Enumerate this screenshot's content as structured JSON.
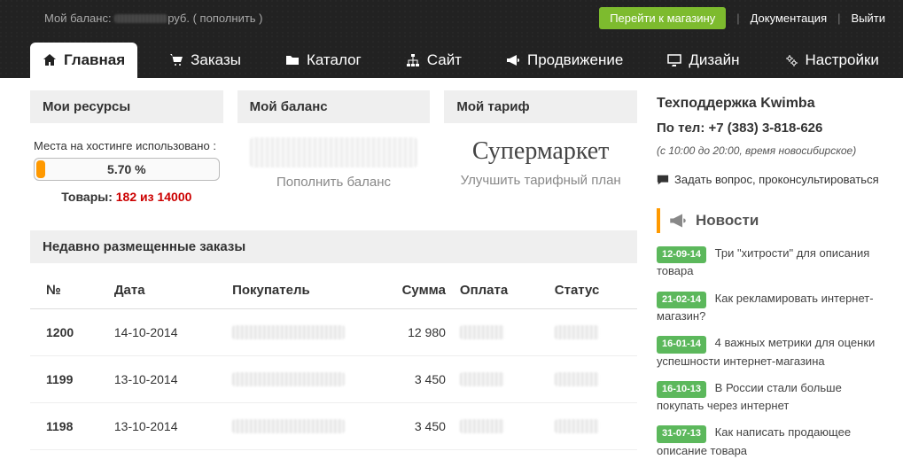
{
  "topbar": {
    "balance_label": "Мой баланс:",
    "balance_value": "руб.",
    "topup": "пополнить",
    "go_shop": "Перейти к магазину",
    "docs": "Документация",
    "logout": "Выйти"
  },
  "tabs": [
    {
      "label": "Главная",
      "icon": "home"
    },
    {
      "label": "Заказы",
      "icon": "cart"
    },
    {
      "label": "Каталог",
      "icon": "folder"
    },
    {
      "label": "Сайт",
      "icon": "sitemap"
    },
    {
      "label": "Продвижение",
      "icon": "bullhorn"
    },
    {
      "label": "Дизайн",
      "icon": "monitor"
    },
    {
      "label": "Настройки",
      "icon": "cogs"
    }
  ],
  "resources": {
    "title": "Мои ресурсы",
    "hosting_label": "Места на хостинге использовано :",
    "hosting_percent": "5.70 %",
    "goods_label": "Товары: ",
    "goods_value": "182 из 14000"
  },
  "balance_card": {
    "title": "Мой баланс",
    "topup_link": "Пополнить баланс"
  },
  "tariff_card": {
    "title": "Мой тариф",
    "name": "Супермаркет",
    "upgrade_link": "Улучшить тарифный план"
  },
  "orders": {
    "title": "Недавно размещенные заказы",
    "headers": {
      "no": "№",
      "date": "Дата",
      "buyer": "Покупатель",
      "sum": "Сумма",
      "pay": "Оплата",
      "status": "Статус"
    },
    "rows": [
      {
        "no": "1200",
        "date": "14-10-2014",
        "sum": "12 980"
      },
      {
        "no": "1199",
        "date": "13-10-2014",
        "sum": "3 450"
      },
      {
        "no": "1198",
        "date": "13-10-2014",
        "sum": "3 450"
      }
    ]
  },
  "support": {
    "title": "Техподдержка Kwimba",
    "phone_label": "По тел: ",
    "phone": "+7 (383) 3-818-626",
    "hours": "(с 10:00 до 20:00, время новосибирское)",
    "ask": "Задать вопрос, проконсультироваться"
  },
  "news": {
    "title": "Новости",
    "items": [
      {
        "date": "12-09-14",
        "text": "Три \"хитрости\" для описания товара"
      },
      {
        "date": "21-02-14",
        "text": "Как рекламировать интернет-магазин?"
      },
      {
        "date": "16-01-14",
        "text": "4 важных метрики для оценки успешности интернет-магазина"
      },
      {
        "date": "16-10-13",
        "text": "В России стали больше покупать через интернет"
      },
      {
        "date": "31-07-13",
        "text": "Как написать продающее описание товара"
      }
    ]
  }
}
